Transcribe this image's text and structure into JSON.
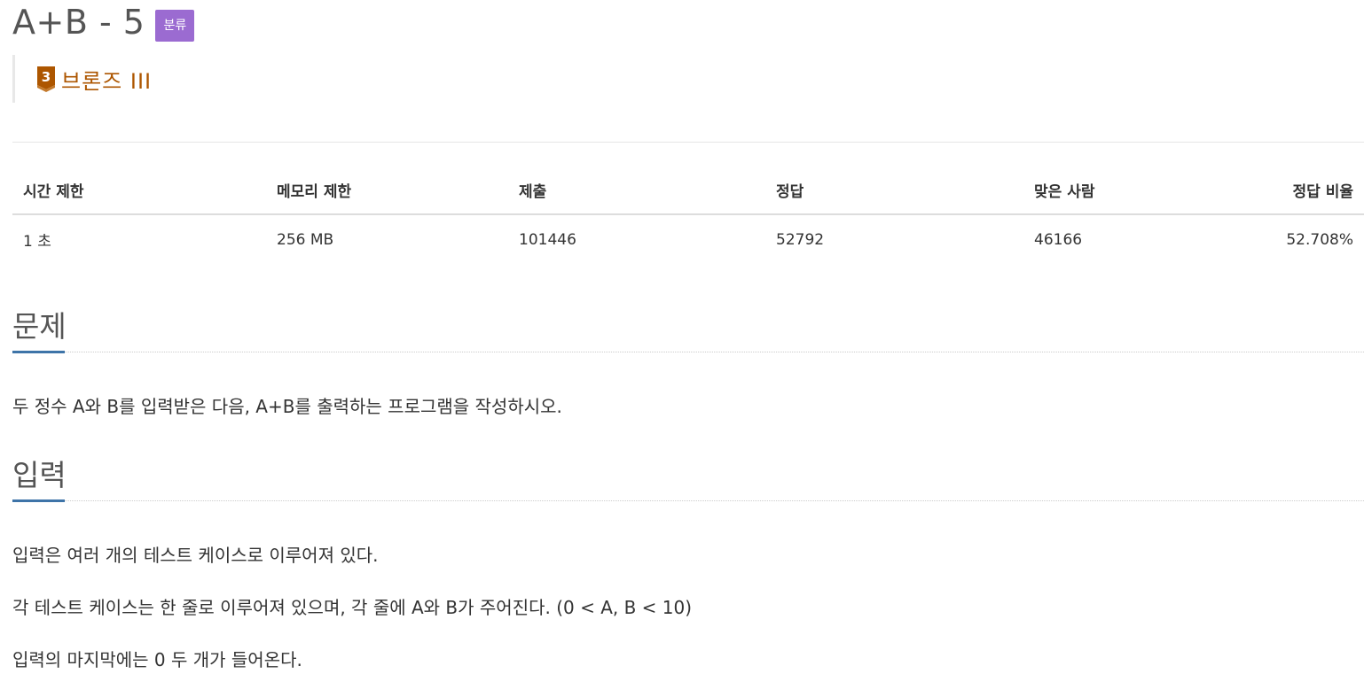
{
  "problem": {
    "title": "A+B - 5",
    "tag_badge": "분류",
    "tier": {
      "number": "3",
      "label": "브론즈 III",
      "color": "#ad5600"
    }
  },
  "info_table": {
    "headers": [
      "시간 제한",
      "메모리 제한",
      "제출",
      "정답",
      "맞은 사람",
      "정답 비율"
    ],
    "row": [
      "1 초",
      "256 MB",
      "101446",
      "52792",
      "46166",
      "52.708%"
    ]
  },
  "sections": {
    "problem": {
      "heading": "문제",
      "paragraphs": [
        "두 정수 A와 B를 입력받은 다음, A+B를 출력하는 프로그램을 작성하시오."
      ]
    },
    "input": {
      "heading": "입력",
      "paragraphs": [
        "입력은 여러 개의 테스트 케이스로 이루어져 있다.",
        "각 테스트 케이스는 한 줄로 이루어져 있으며, 각 줄에 A와 B가 주어진다. (0 < A, B < 10)",
        "입력의 마지막에는 0 두 개가 들어온다."
      ]
    }
  },
  "colors": {
    "tag_badge_bg": "#9b6bd1",
    "heading_accent": "#3e74a8",
    "bronze": "#ad5600"
  },
  "icons": {
    "tier": "bronze-tier-icon"
  }
}
